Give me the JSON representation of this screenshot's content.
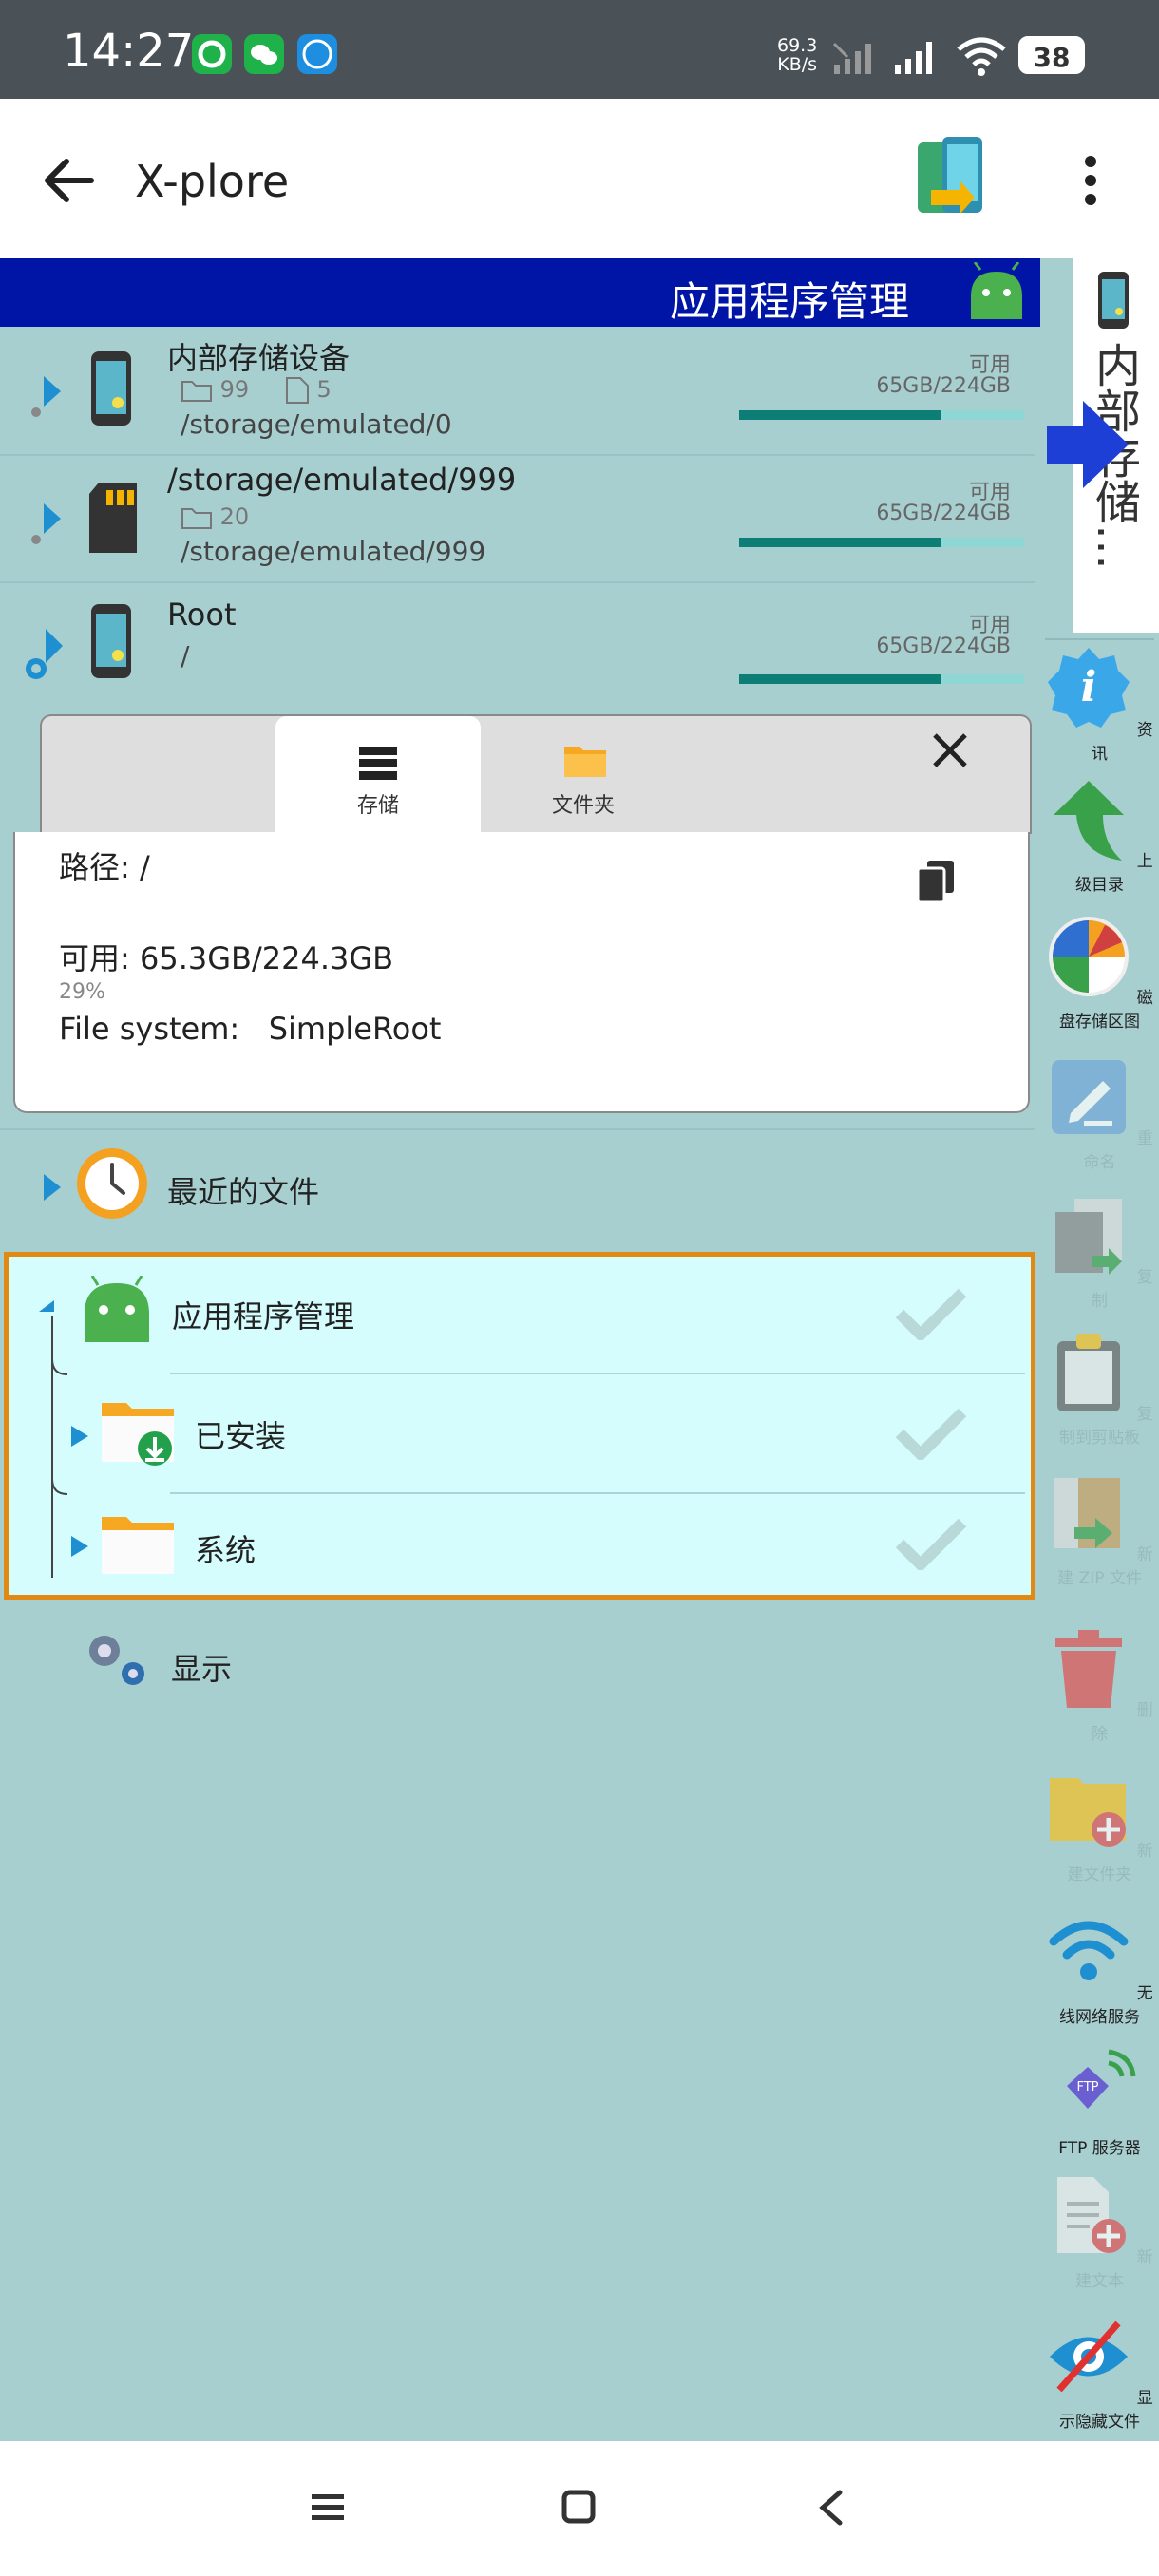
{
  "status_bar": {
    "time": "14:27",
    "net_speed_value": "69.3",
    "net_speed_unit": "KB/s",
    "battery": "38"
  },
  "app_bar": {
    "title": "X-plore"
  },
  "panel": {
    "header_title": "应用程序管理",
    "storages": [
      {
        "name": "内部存储设备",
        "folders": "99",
        "files": "5",
        "path": "/storage/emulated/0",
        "avail_label": "可用",
        "avail": "65GB/224GB",
        "used_fraction": 0.71
      },
      {
        "name": "/storage/emulated/999",
        "folders": "20",
        "path": "/storage/emulated/999",
        "avail_label": "可用",
        "avail": "65GB/224GB",
        "used_fraction": 0.71
      },
      {
        "name": "Root",
        "path": "/",
        "avail_label": "可用",
        "avail": "65GB/224GB",
        "used_fraction": 0.71
      }
    ],
    "info_popup": {
      "tab_storage": "存储",
      "tab_folder": "文件夹",
      "path_label": "路径",
      "path_value": "/",
      "avail_label": "可用",
      "avail_value": "65.3GB/224.3GB",
      "percent": "29%",
      "fs_label": "File system",
      "fs_value": "SimpleRoot"
    },
    "recent_files": "最近的文件",
    "app_manager": {
      "title": "应用程序管理",
      "children": [
        "已安装",
        "系统"
      ]
    },
    "display": "显示"
  },
  "right_rail": {
    "tab_label": "内部存储…",
    "items": [
      {
        "label": "资讯",
        "icon": "info-icon",
        "enabled": true
      },
      {
        "label": "上级目录",
        "icon": "up-arrow-icon",
        "enabled": true
      },
      {
        "label": "磁盘存储区图",
        "icon": "disk-map-icon",
        "enabled": true
      },
      {
        "label": "重命名",
        "icon": "rename-icon",
        "enabled": false
      },
      {
        "label": "复制",
        "icon": "copy-icon",
        "enabled": false
      },
      {
        "label": "复制到剪贴板",
        "icon": "clipboard-icon",
        "enabled": false
      },
      {
        "label": "新建 ZIP 文件",
        "icon": "zip-icon",
        "enabled": false
      },
      {
        "label": "删除",
        "icon": "trash-icon",
        "enabled": false
      },
      {
        "label": "新建文件夹",
        "icon": "new-folder-icon",
        "enabled": false
      },
      {
        "label": "无线网络服务",
        "icon": "wifi-icon",
        "enabled": true
      },
      {
        "label": "FTP 服务器",
        "icon": "ftp-icon",
        "enabled": true
      },
      {
        "label": "新建文本",
        "icon": "new-text-icon",
        "enabled": false
      },
      {
        "label": "显示隐藏文件",
        "icon": "hidden-files-icon",
        "enabled": true
      }
    ]
  },
  "colors": {
    "panel_bg": "#a8cfd0",
    "header_blue": "#0015a5",
    "selection_border": "#e08a14",
    "selection_bg": "#d5fdfd",
    "bar_fill": "#0d7e76"
  }
}
